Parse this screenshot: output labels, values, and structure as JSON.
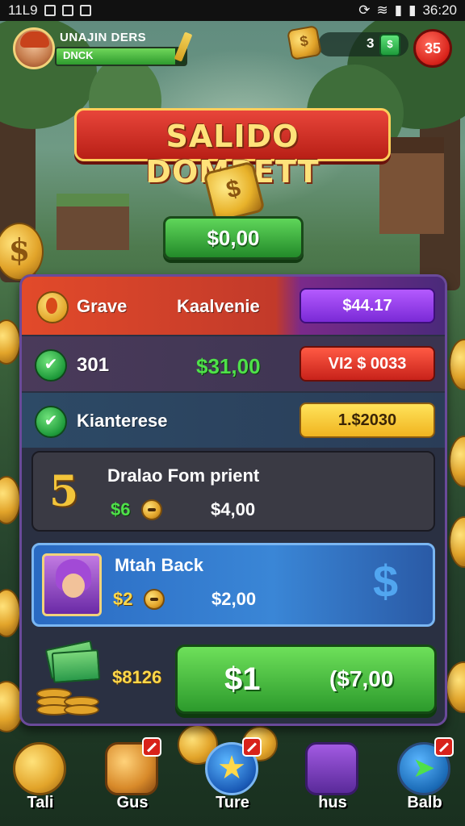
{
  "status_bar": {
    "time_left": "11L9",
    "time_right": "36:20"
  },
  "player": {
    "name": "UNAJIN DERS",
    "tag": "DNCK",
    "xp_fraction": 0.92
  },
  "currency": {
    "coin_symbol": "$",
    "gems": "3",
    "gem_symbol": "$",
    "notifications": "35"
  },
  "title": "SALIDO DOMPETT",
  "chest_symbol": "$",
  "balance": "$0,00",
  "rows": [
    {
      "left": "Grave",
      "middle": "Kaalvenie",
      "value": "$44.17"
    },
    {
      "left": "301",
      "middle": "$31,00",
      "value": "VI2 $ 0033"
    },
    {
      "left": "Kianterese",
      "middle": "",
      "value": "1.$2030"
    }
  ],
  "prize_card": {
    "number": "5",
    "title": "Dralao Fom prient",
    "green": "$6",
    "amount": "$4,00"
  },
  "back_card": {
    "title": "Mtah Back",
    "yellow": "$2",
    "amount": "$2,00",
    "watermark": "$"
  },
  "purchase": {
    "price_label": "$8126",
    "button_main": "$1",
    "button_sub": "($7,00"
  },
  "nav": [
    {
      "label": "Tali",
      "icon": "coin-icon"
    },
    {
      "label": "Gus",
      "icon": "coin-icon"
    },
    {
      "label": "Ture",
      "icon": "star-icon"
    },
    {
      "label": "hus",
      "icon": "coin-stack-icon"
    },
    {
      "label": "Balb",
      "icon": "arrow-icon"
    }
  ],
  "colors": {
    "accent_red": "#d8221a",
    "accent_green": "#2c9a2c",
    "accent_purple": "#7a2ad6",
    "gold": "#e2a42a"
  }
}
